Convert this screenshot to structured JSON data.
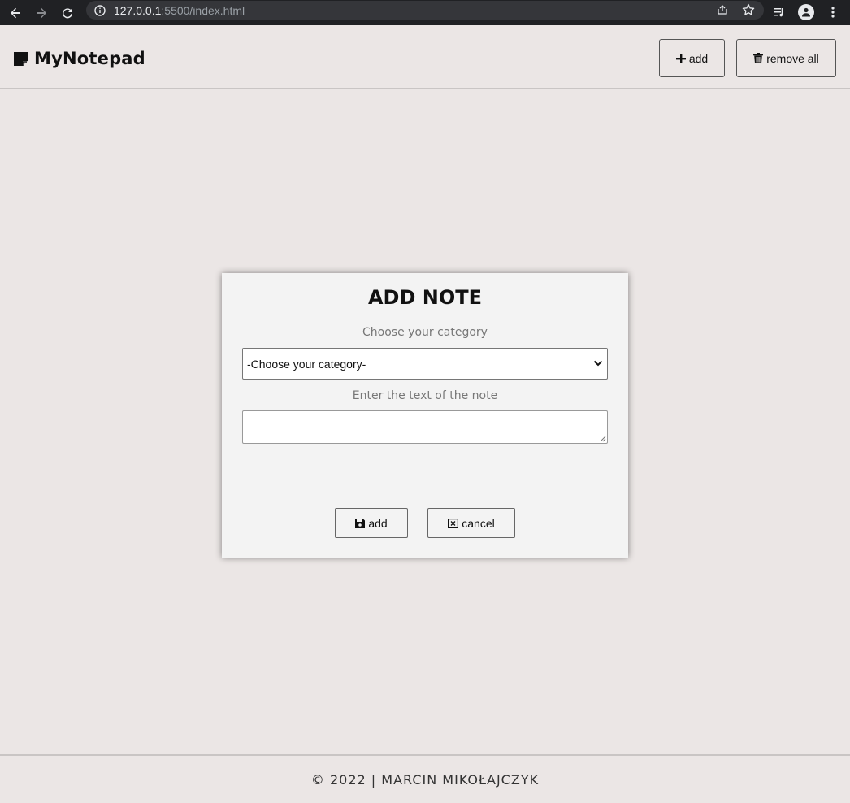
{
  "browser": {
    "url_host": "127.0.0.1",
    "url_path": ":5500/index.html"
  },
  "header": {
    "title": "MyNotepad",
    "add_label": "add",
    "remove_all_label": "remove all"
  },
  "modal": {
    "title": "ADD NOTE",
    "category_label": "Choose your category",
    "category_selected": "-Choose your category-",
    "text_label": "Enter the text of the note",
    "text_value": "",
    "save_label": "add",
    "cancel_label": "cancel"
  },
  "footer": {
    "text": "© 2022 | MARCIN MIKOŁAJCZYK"
  }
}
